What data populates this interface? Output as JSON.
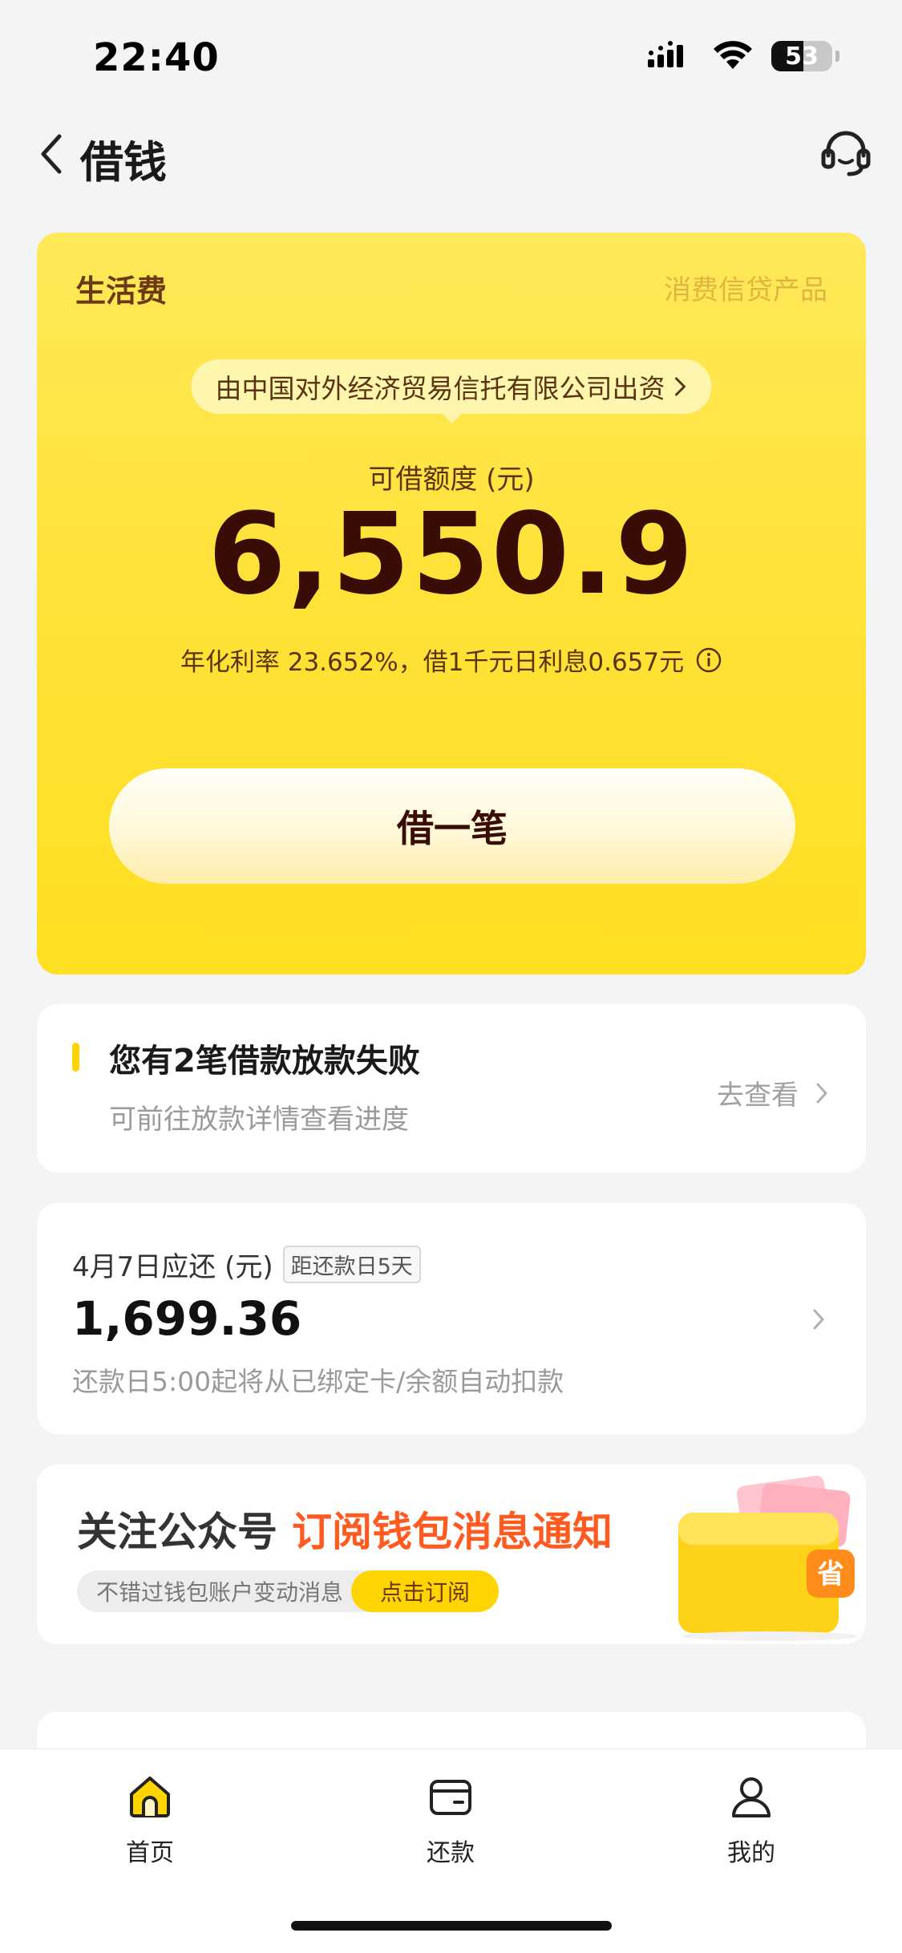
{
  "status_bar": {
    "time": "22:40",
    "battery": "53",
    "battery_level": 0.53
  },
  "nav": {
    "title": "借钱",
    "back_icon": "chevron-left-icon",
    "service_icon": "headset-icon"
  },
  "loan_card": {
    "label": "生活费",
    "tag": "消费信贷产品",
    "lender": "由中国对外经济贸易信托有限公司出资",
    "limit_label": "可借额度 (元)",
    "limit_amount": "6,550.9",
    "rate_text": "年化利率 23.652%，借1千元日利息0.657元",
    "borrow_button": "借一笔"
  },
  "fail_notice": {
    "title": "您有2笔借款放款失败",
    "subtitle": "可前往放款详情查看进度",
    "link": "去查看"
  },
  "repayment": {
    "label": "4月7日应还 (元)",
    "badge": "距还款日5天",
    "amount": "1,699.36",
    "note": "还款日5:00起将从已绑定卡/余额自动扣款"
  },
  "subscribe": {
    "title": "关注公众号",
    "highlight": "订阅钱包消息通知",
    "pill_text": "不错过钱包账户变动消息",
    "pill_button": "点击订阅",
    "illustration_char": "省"
  },
  "tabbar": {
    "tabs": [
      {
        "label": "首页",
        "icon": "home-icon",
        "active": true
      },
      {
        "label": "还款",
        "icon": "wallet-icon",
        "active": false
      },
      {
        "label": "我的",
        "icon": "person-icon",
        "active": false
      }
    ]
  },
  "colors": {
    "accent_yellow": "#ffd400",
    "amount_dark": "#3a0c06",
    "highlight_orange": "#ff5a1f"
  }
}
